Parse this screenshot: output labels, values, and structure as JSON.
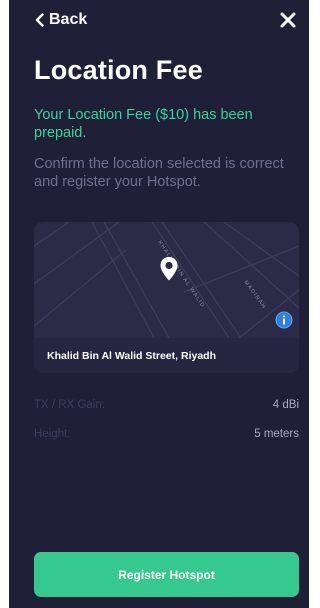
{
  "header": {
    "back_label": "Back",
    "close_icon": "close-icon"
  },
  "page": {
    "title": "Location Fee",
    "prepaid_message": "Your Location Fee ($10) has been prepaid.",
    "confirm_message": "Confirm the location selected is correct and register your Hotspot."
  },
  "map": {
    "address": "Khalid Bin Al Walid Street, Riyadh",
    "street_label_main": "KHALID BIN AL WALID",
    "street_label_side": "MADINAH",
    "pin_icon": "location-pin-icon",
    "info_icon": "info-icon"
  },
  "details": {
    "gain_label": "TX / RX Gain:",
    "gain_value": "4 dBi",
    "height_label": "Height:",
    "height_value": "5 meters"
  },
  "footer": {
    "register_label": "Register Hotspot"
  },
  "colors": {
    "background": "#1f1f37",
    "accent_green": "#36d697",
    "button_green": "#36c98f",
    "muted_text": "#6f7090",
    "map_background": "#2b2b48",
    "info_blue": "#2f7fe0"
  }
}
